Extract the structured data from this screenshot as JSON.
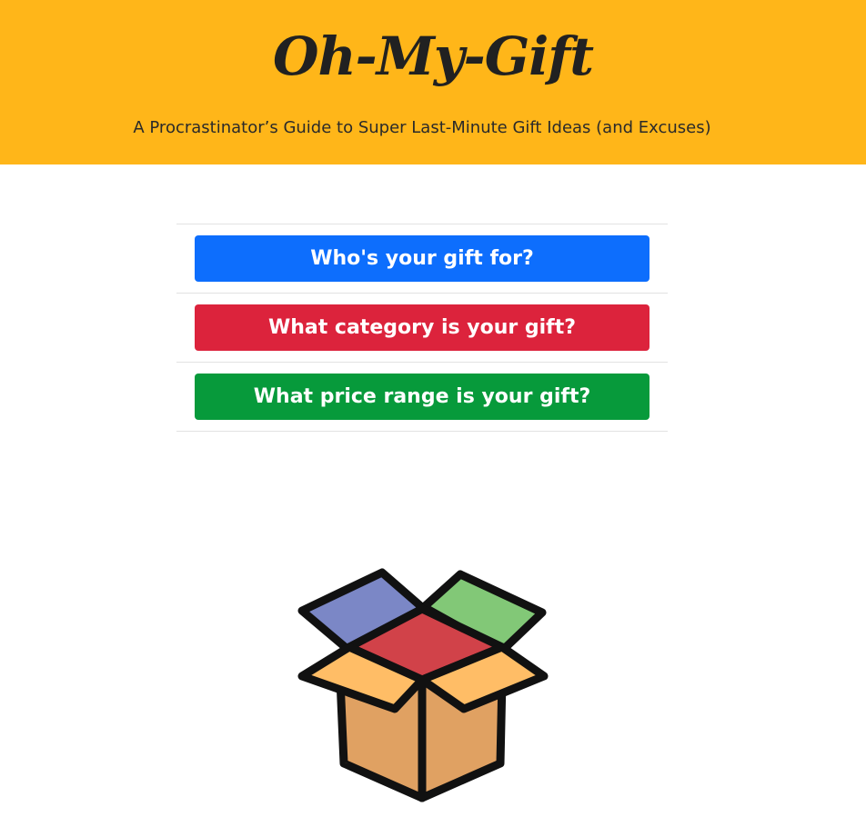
{
  "header": {
    "brand": "Oh-My-Gift",
    "tagline": "A Procrastinator’s Guide to Super Last-Minute Gift Ideas (and Excuses)",
    "background_color": "#ffb619"
  },
  "questions": [
    {
      "label": "Who's your gift for?",
      "color": "#0d6efd"
    },
    {
      "label": "What category is your gift?",
      "color": "#dc233c"
    },
    {
      "label": "What price range is your gift?",
      "color": "#079a3b"
    }
  ],
  "illustration": {
    "icon": "open-gift-box-icon",
    "colors": {
      "left_flap": "#7b87c6",
      "right_flap": "#82c877",
      "inside": "#d14249",
      "front_flaps": "#ffbd66",
      "box_body": "#e0a162",
      "outline": "#111111"
    }
  }
}
